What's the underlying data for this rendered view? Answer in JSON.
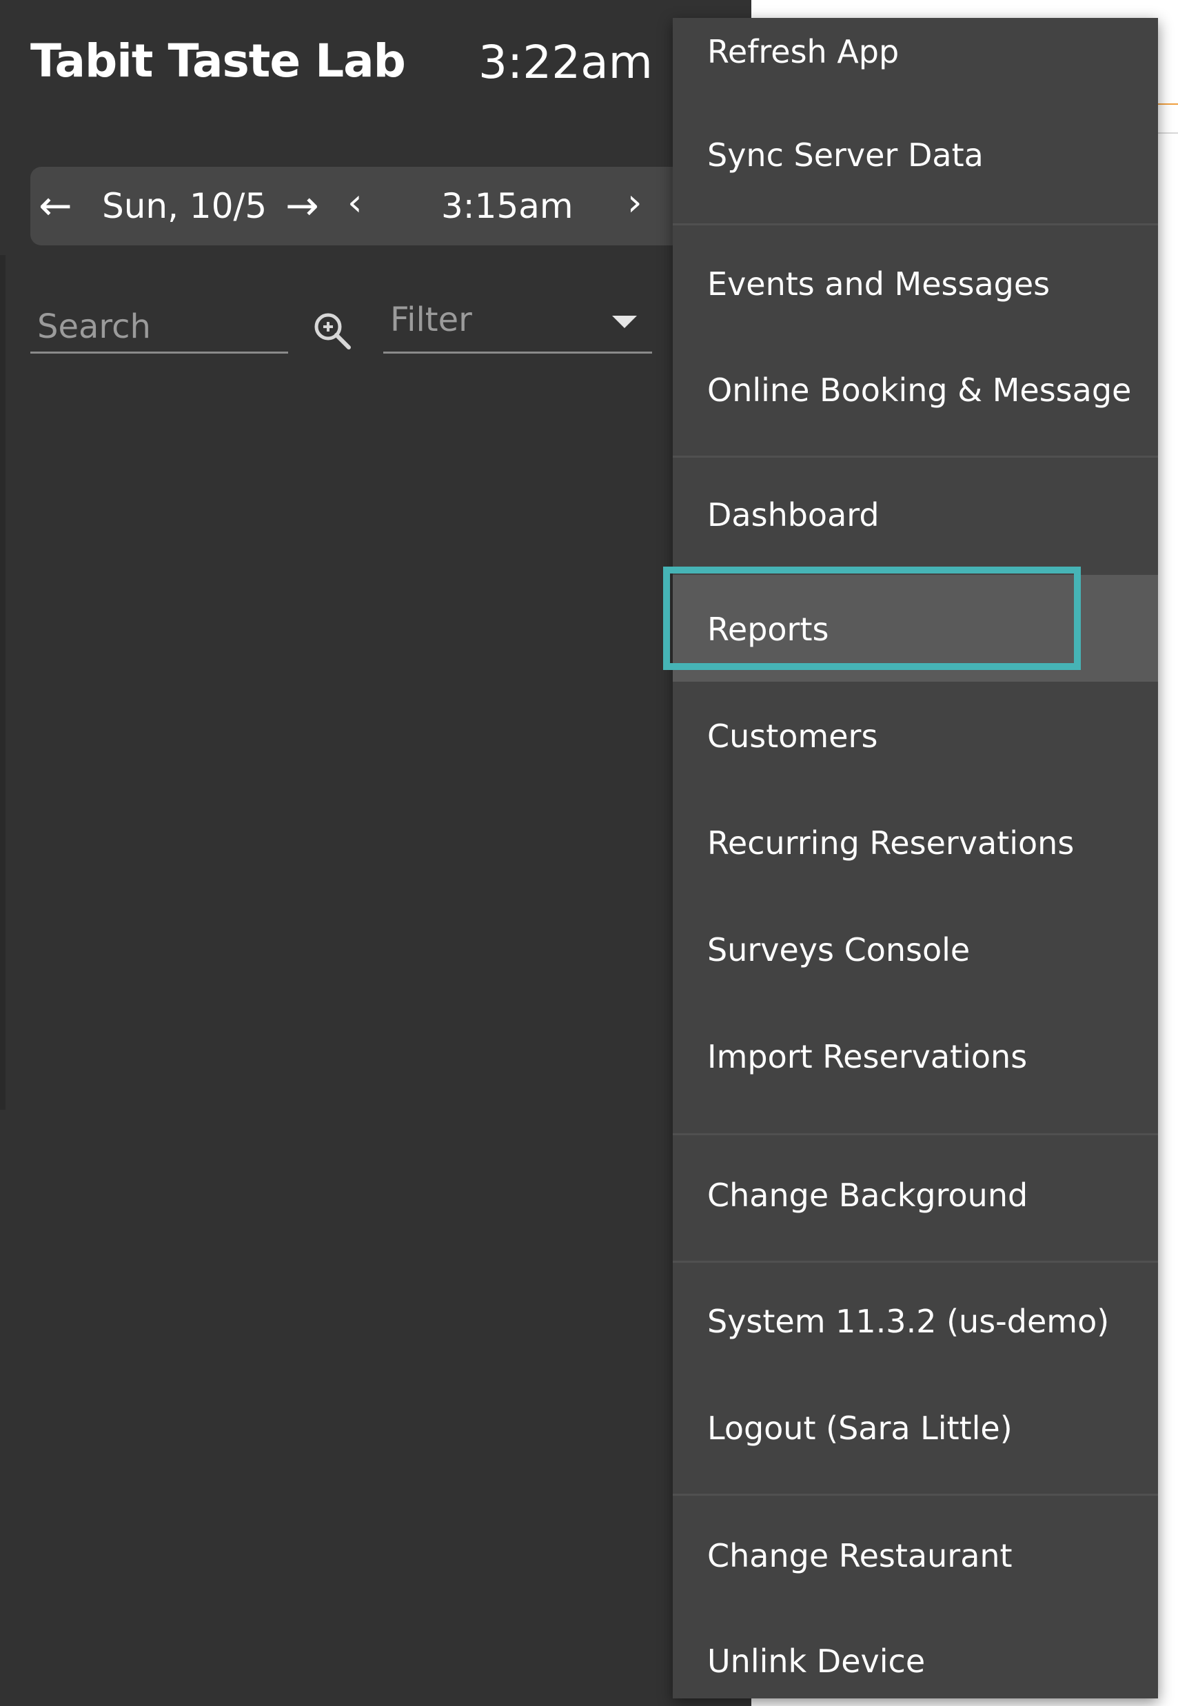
{
  "header": {
    "restaurant_name": "Tabit Taste Lab",
    "clock": "3:22am"
  },
  "date_nav": {
    "prev_day_icon": "arrow-left-icon",
    "date": "Sun, 10/5",
    "next_day_icon": "arrow-right-icon",
    "prev_time_icon": "chevron-left-icon",
    "time": "3:15am",
    "next_time_icon": "chevron-right-icon"
  },
  "search": {
    "placeholder": "Search",
    "value": "",
    "icon": "zoom-in-icon"
  },
  "filter": {
    "label": "Filter",
    "icon": "caret-down-icon"
  },
  "menu": {
    "selected": "Reports",
    "highlight_color": "#46b4b6",
    "items": [
      {
        "label": "Refresh App"
      },
      {
        "label": "Sync Server Data"
      },
      {
        "label": "Events and Messages"
      },
      {
        "label": "Online Booking & Message"
      },
      {
        "label": "Dashboard"
      },
      {
        "label": "Reports"
      },
      {
        "label": "Customers"
      },
      {
        "label": "Recurring Reservations"
      },
      {
        "label": "Surveys Console"
      },
      {
        "label": "Import Reservations"
      },
      {
        "label": "Change Background"
      },
      {
        "label": "System 11.3.2 (us-demo)"
      },
      {
        "label": "Logout (Sara Little)"
      },
      {
        "label": "Change Restaurant"
      },
      {
        "label": "Unlink Device"
      }
    ]
  },
  "colors": {
    "panel_bg": "#323232",
    "menu_bg": "#434343",
    "active_bg": "#5a5a5a",
    "accent_orange": "#f0a040"
  }
}
